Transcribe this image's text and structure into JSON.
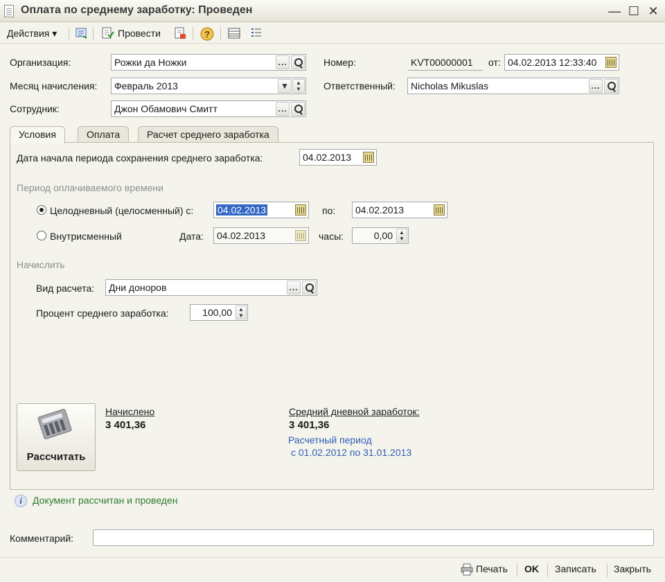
{
  "window": {
    "title": "Оплата по среднему заработку: Проведен",
    "minimize": "—",
    "maximize": "☐",
    "close": "✕"
  },
  "toolbar": {
    "actions": "Действия ▾",
    "post": "Провести",
    "help": "?"
  },
  "header": {
    "organization_label": "Организация:",
    "organization_value": "Рожки да Ножки",
    "month_label": "Месяц начисления:",
    "month_value": "Февраль 2013",
    "employee_label": "Сотрудник:",
    "employee_value": "Джон Обамович Смитт",
    "number_label": "Номер:",
    "number_value": "KVT00000001",
    "from_label": "от:",
    "date_value": "04.02.2013 12:33:40",
    "responsible_label": "Ответственный:",
    "responsible_value": "Nicholas Mikuslas"
  },
  "tabs": [
    {
      "label": "Условия"
    },
    {
      "label": "Оплата"
    },
    {
      "label": "Расчет среднего заработка"
    }
  ],
  "conditions": {
    "start_date_label": "Дата начала периода сохранения среднего заработка:",
    "start_date_value": "04.02.2013",
    "period_section": "Период оплачиваемого времени",
    "full_day_label": "Целодневный (целосменный) с:",
    "full_day_from": "04.02.2013",
    "to_label": "по:",
    "full_day_to": "04.02.2013",
    "intrashift_label": "Внутрисменный",
    "date_label": "Дата:",
    "intrashift_date": "04.02.2013",
    "hours_label": "часы:",
    "hours_value": "0,00",
    "accrue_section": "Начислить",
    "calc_type_label": "Вид расчета:",
    "calc_type_value": "Дни доноров",
    "percent_label": "Процент среднего заработка:",
    "percent_value": "100,00",
    "full_day_selected": true
  },
  "results": {
    "calc_button": "Рассчитать",
    "accrued_label": "Начислено",
    "accrued_value": "3 401,36",
    "avg_label": "Средний дневной заработок:",
    "avg_value": "3 401,36",
    "period_label": "Расчетный период",
    "period_value": "с 01.02.2012 по 31.01.2013"
  },
  "status": {
    "message": "Документ рассчитан и проведен"
  },
  "comment": {
    "label": "Комментарий:",
    "value": ""
  },
  "footer": {
    "print": "Печать",
    "ok": "OK",
    "save": "Записать",
    "close": "Закрыть"
  },
  "colors": {
    "background": "#f4f3ec",
    "link": "#2f5db4",
    "status": "#2f7c2f",
    "selection": "#3166c4"
  }
}
